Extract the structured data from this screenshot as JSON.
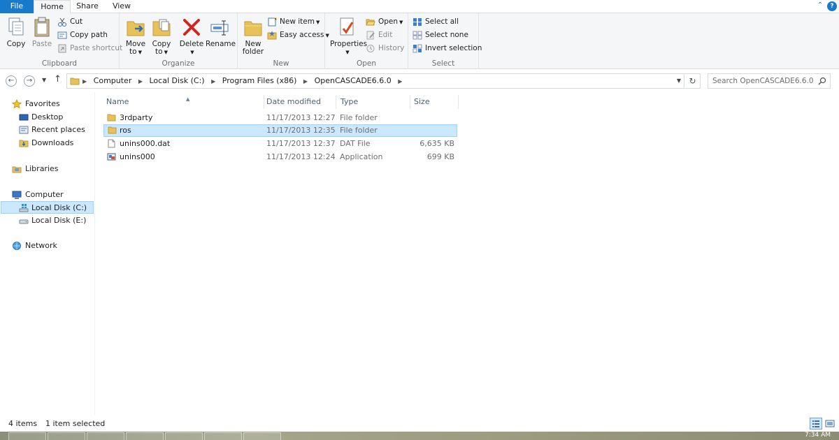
{
  "ribbon_tabs": {
    "file": "File",
    "home": "Home",
    "share": "Share",
    "view": "View"
  },
  "clipboard": {
    "copy": "Copy",
    "paste": "Paste",
    "cut": "Cut",
    "copy_path": "Copy path",
    "paste_shortcut": "Paste shortcut",
    "label": "Clipboard"
  },
  "organize": {
    "move_to": "Move",
    "move_to_2": "to",
    "copy_to": "Copy",
    "copy_to_2": "to",
    "delete": "Delete",
    "rename": "Rename",
    "label": "Organize"
  },
  "new_group": {
    "new_folder": "New",
    "new_folder_2": "folder",
    "new_item": "New item",
    "easy_access": "Easy access",
    "label": "New"
  },
  "open_group": {
    "properties": "Properties",
    "open": "Open",
    "edit": "Edit",
    "history": "History",
    "label": "Open"
  },
  "select_group": {
    "select_all": "Select all",
    "select_none": "Select none",
    "invert_selection": "Invert selection",
    "label": "Select"
  },
  "address": {
    "crumbs": [
      "Computer",
      "Local Disk (C:)",
      "Program Files (x86)",
      "OpenCASCADE6.6.0"
    ],
    "search_placeholder": "Search OpenCASCADE6.6.0"
  },
  "nav_pane": {
    "favorites": "Favorites",
    "desktop": "Desktop",
    "recent_places": "Recent places",
    "downloads": "Downloads",
    "libraries": "Libraries",
    "computer": "Computer",
    "local_disk_c": "Local Disk (C:)",
    "local_disk_e": "Local Disk (E:)",
    "network": "Network"
  },
  "columns": {
    "name": "Name",
    "date_modified": "Date modified",
    "type": "Type",
    "size": "Size"
  },
  "files": [
    {
      "name": "3rdparty",
      "date": "11/17/2013 12:27 ...",
      "type": "File folder",
      "size": ""
    },
    {
      "name": "ros",
      "date": "11/17/2013 12:35 ...",
      "type": "File folder",
      "size": ""
    },
    {
      "name": "unins000.dat",
      "date": "11/17/2013 12:37 ...",
      "type": "DAT File",
      "size": "6,635 KB"
    },
    {
      "name": "unins000",
      "date": "11/17/2013 12:24 ...",
      "type": "Application",
      "size": "699 KB"
    }
  ],
  "status": {
    "item_count": "4 items",
    "selected": "1 item selected"
  },
  "taskbar": {
    "clock": "7:34 AM"
  },
  "colors": {
    "accent": "#1979ca",
    "selection": "#cce8ff",
    "folder": "#e8c15a"
  }
}
